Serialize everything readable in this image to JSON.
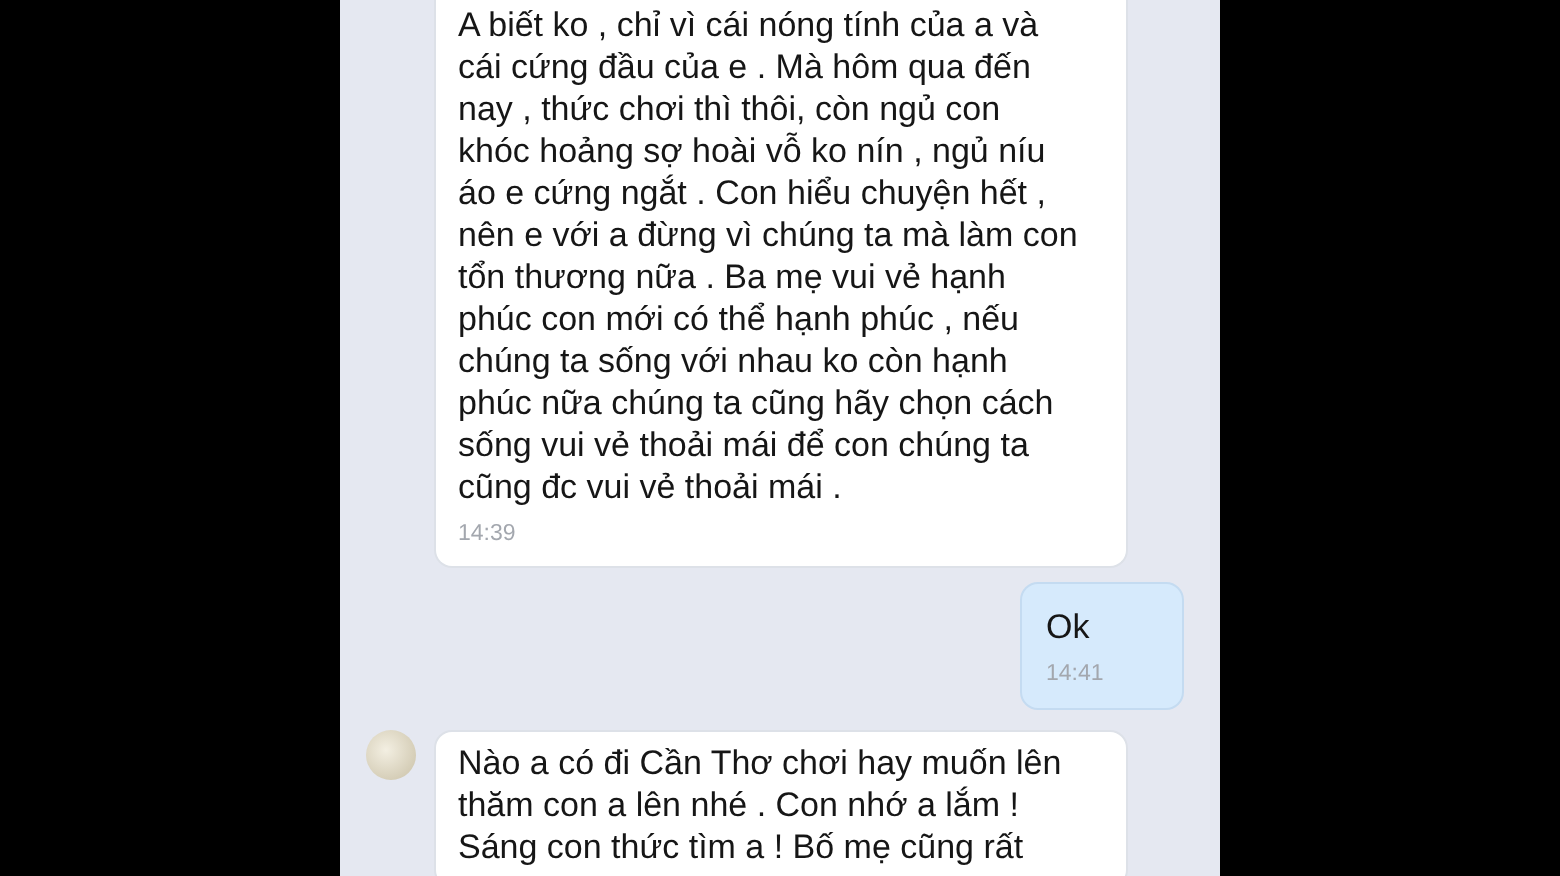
{
  "messages": [
    {
      "kind": "received",
      "avatar": false,
      "text": "A biết ko , chỉ vì cái nóng tính của a và\ncái cứng đầu của e . Mà hôm qua đến\nnay , thức chơi thì thôi, còn ngủ con\nkhóc hoảng sợ hoài vỗ ko nín , ngủ níu\náo e cứng ngắt . Con hiểu chuyện hết ,\nnên e với a đừng vì chúng ta mà làm con\ntổn thương nữa . Ba mẹ vui vẻ hạnh\nphúc con mới có thể hạnh phúc , nếu\nchúng ta sống với nhau ko còn hạnh\nphúc nữa chúng ta cũng hãy chọn cách\nsống vui vẻ thoải mái để con chúng ta\ncũng đc vui vẻ thoải mái .",
      "time": "14:39"
    },
    {
      "kind": "sent",
      "avatar": false,
      "text": "Ok",
      "time": "14:41"
    },
    {
      "kind": "received",
      "avatar": true,
      "text": "Nào a có đi Cần Thơ chơi hay muốn lên\nthăm con a lên nhé . Con nhớ a lắm !\nSáng con thức tìm a ! Bố mẹ cũng rất"
    }
  ]
}
